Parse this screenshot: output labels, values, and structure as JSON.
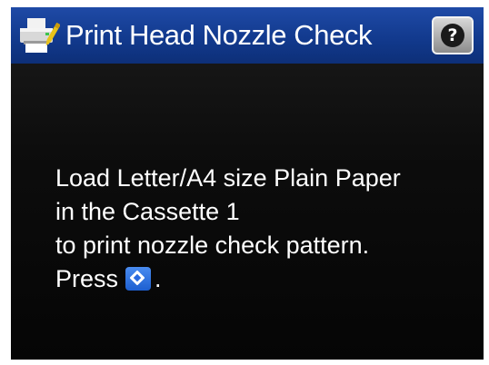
{
  "header": {
    "title": "Print Head Nozzle Check",
    "printer_icon": "printer-icon",
    "help_icon": "help-icon",
    "help_glyph": "?"
  },
  "message": {
    "line1": "Load Letter/A4 size Plain Paper",
    "line2": "in the Cassette 1",
    "line3": "to print nozzle check pattern.",
    "line4_prefix": "Press",
    "line4_icon": "start-icon",
    "line4_suffix": "."
  },
  "colors": {
    "title_bar": "#123a8e",
    "background": "#0d0d0d",
    "text": "#ffffff",
    "start_button": "#2a6ae0"
  }
}
